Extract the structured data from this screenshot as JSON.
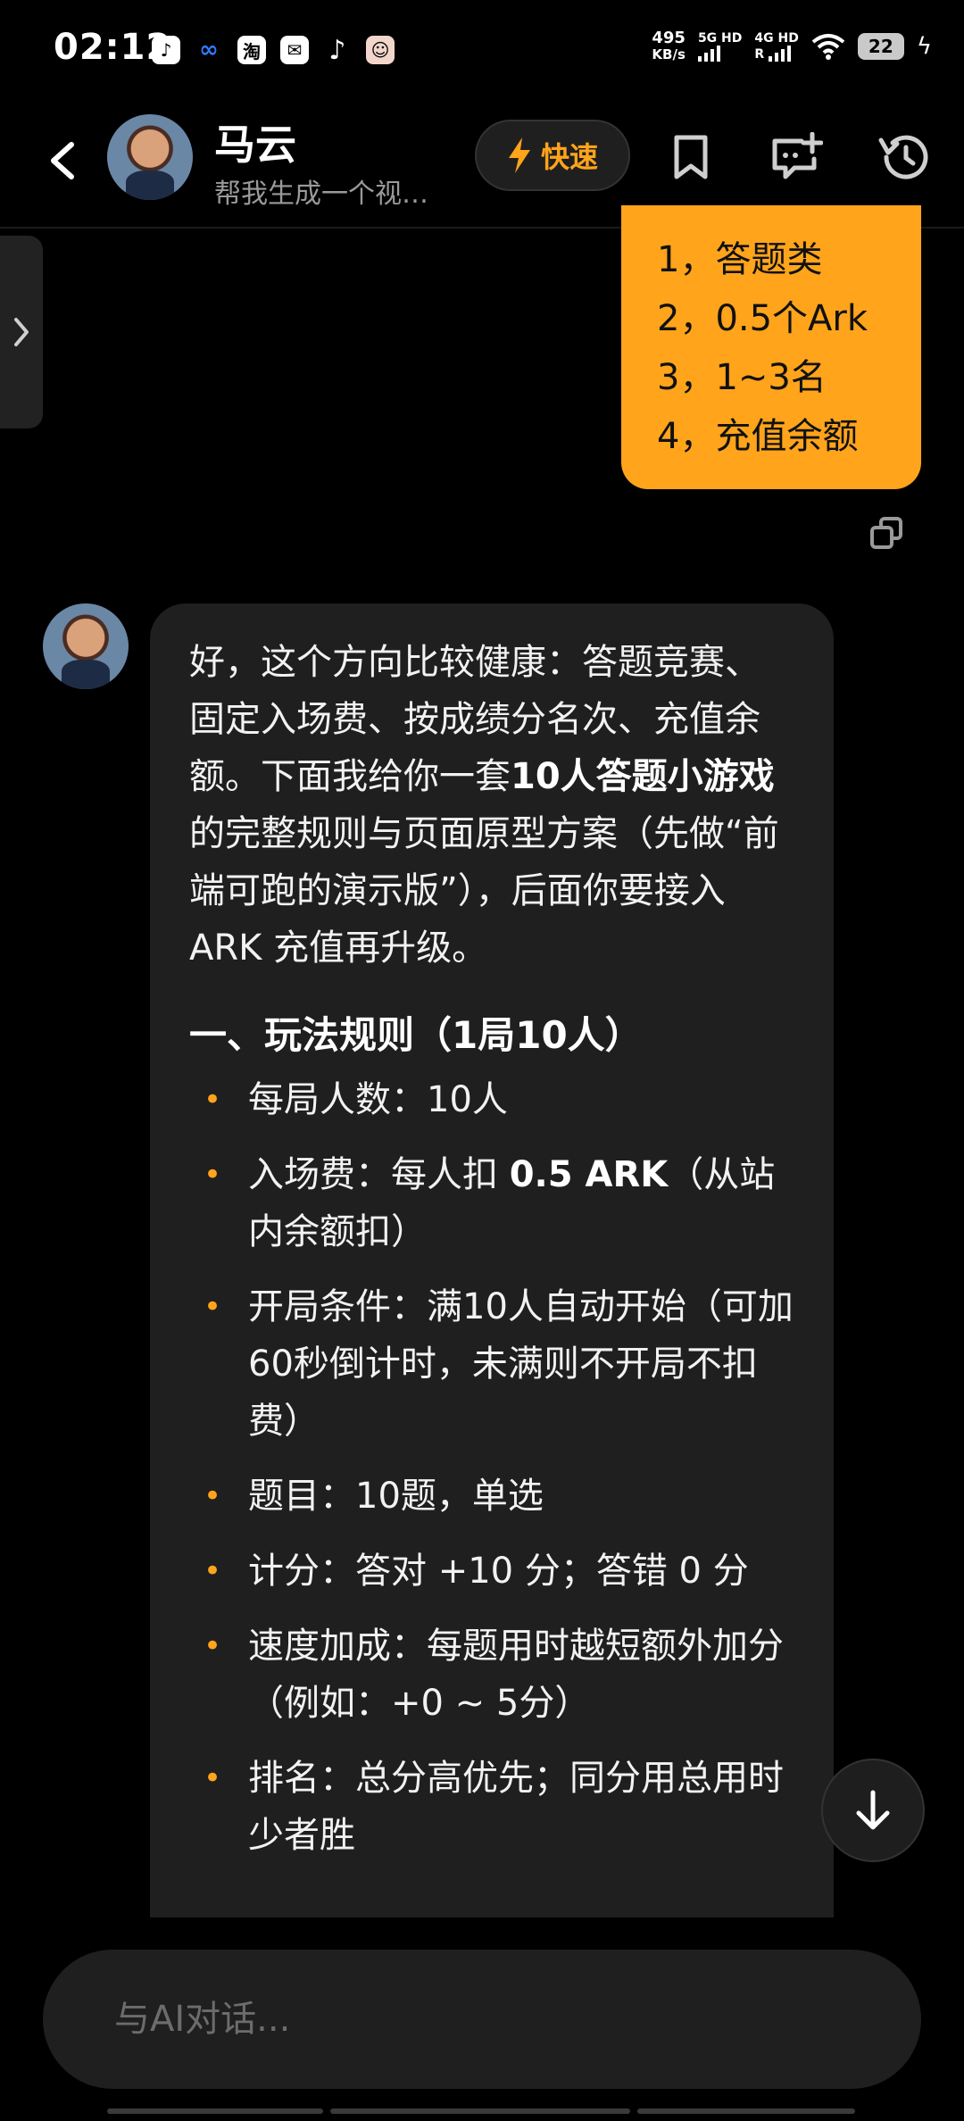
{
  "status_bar": {
    "time": "02:12",
    "speed_value": "495",
    "speed_unit": "KB/s",
    "net1": "5G HD",
    "net2": "4G HD",
    "net2_r": "R",
    "battery": "22",
    "app_icons": [
      "douyin-icon",
      "meta-icon",
      "taobao-icon",
      "mail-icon",
      "tiktok-icon",
      "face-icon"
    ],
    "taobao_glyph": "淘"
  },
  "header": {
    "title": "马云",
    "subtitle": "帮我生成一个视…",
    "fast_label": "快速",
    "accent": "#ffa41b"
  },
  "user_message": {
    "lines": [
      "1，答题类",
      "2，0.5个Ark",
      "3，1~3名",
      "4，充值余额"
    ]
  },
  "ai_message": {
    "intro_1": "好，这个方向比较健康：答题竞赛、固定入场费、按成绩分名次、充值余额。下面我给你一套",
    "intro_bold": "10人答题小游戏",
    "intro_2": "的完整规则与页面原型方案（先做“前端可跑的演示版”），后面你要接入 ARK 充值再升级。",
    "section_title": "一、玩法规则（1局10人）",
    "rules": [
      {
        "text": "每局人数：10人",
        "bold": "",
        "after": ""
      },
      {
        "text": "入场费：每人扣 ",
        "bold": "0.5 ARK",
        "after": "（从站内余额扣）"
      },
      {
        "text": "开局条件：满10人自动开始（可加60秒倒计时，未满则不开局不扣费）",
        "bold": "",
        "after": ""
      },
      {
        "text": "题目：10题，单选",
        "bold": "",
        "after": ""
      },
      {
        "text": "计分：答对 +10 分；答错 0 分",
        "bold": "",
        "after": ""
      },
      {
        "text": "速度加成：每题用时越短额外加分（例如：+0 ~ 5分）",
        "bold": "",
        "after": ""
      },
      {
        "text": "排名：总分高优先；同分用总用时少者胜",
        "bold": "",
        "after": ""
      }
    ]
  },
  "input": {
    "placeholder": "与AI对话..."
  }
}
